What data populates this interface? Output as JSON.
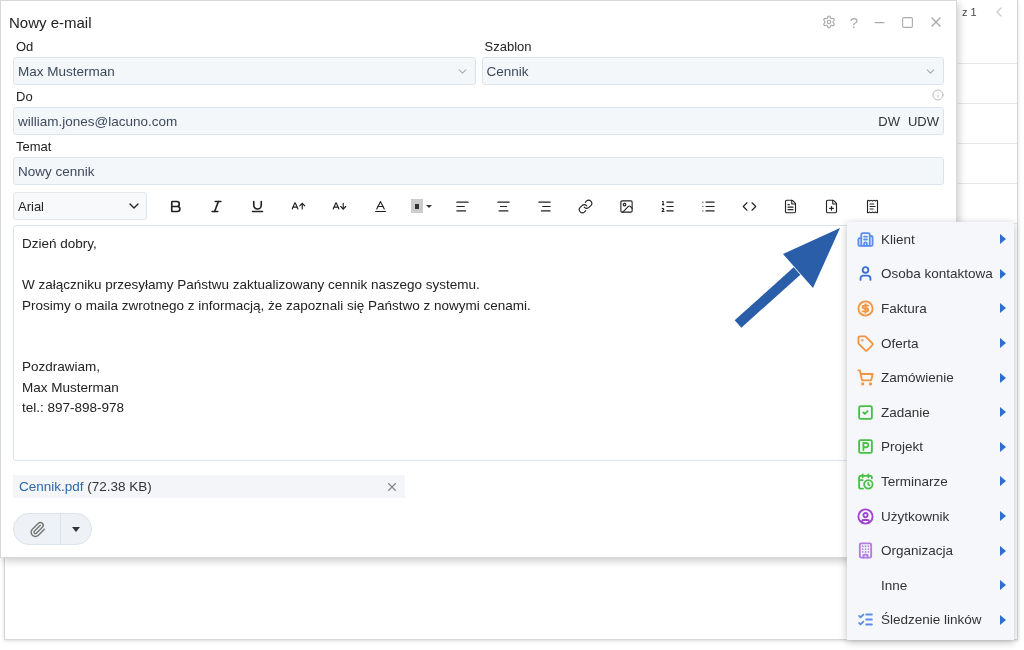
{
  "background": {
    "page_text": "z 1"
  },
  "window": {
    "title": "Nowy e-mail",
    "help_label": "?"
  },
  "form": {
    "from": {
      "label": "Od",
      "value": "Max Musterman"
    },
    "template": {
      "label": "Szablon",
      "value": "Cennik"
    },
    "to": {
      "label": "Do",
      "value": "william.jones@lacuno.com",
      "links": [
        "DW",
        "UDW"
      ]
    },
    "subject": {
      "label": "Temat",
      "value": "Nowy cennik"
    }
  },
  "toolbar": {
    "font": "Arial"
  },
  "body": {
    "blocks": [
      [
        "Dzień dobry,"
      ],
      [
        "W załączniku przesyłamy Państwu zaktualizowany cennik naszego systemu.",
        "Prosimy o maila zwrotnego z informacją, że zapoznali się Państwo z nowymi cenami."
      ],
      [
        "Pozdrawiam,",
        "Max Musterman",
        "tel.: 897-898-978"
      ]
    ]
  },
  "attachment": {
    "name": "Cennik.pdf",
    "size": "(72.38 KB)"
  },
  "menu": {
    "items": [
      {
        "label": "Klient",
        "color": "#5b8def"
      },
      {
        "label": "Osoba kontaktowa",
        "color": "#3a6fd6"
      },
      {
        "label": "Faktura",
        "color": "#f5953f"
      },
      {
        "label": "Oferta",
        "color": "#f5953f"
      },
      {
        "label": "Zamówienie",
        "color": "#f5953f"
      },
      {
        "label": "Zadanie",
        "color": "#46c146"
      },
      {
        "label": "Projekt",
        "color": "#46c146"
      },
      {
        "label": "Terminarze",
        "color": "#46c146"
      },
      {
        "label": "Użytkownik",
        "color": "#a243d3"
      },
      {
        "label": "Organizacja",
        "color": "#b57be0"
      },
      {
        "label": "Inne"
      },
      {
        "label": "Śledzenie linków",
        "color": "#5b8def"
      }
    ]
  }
}
